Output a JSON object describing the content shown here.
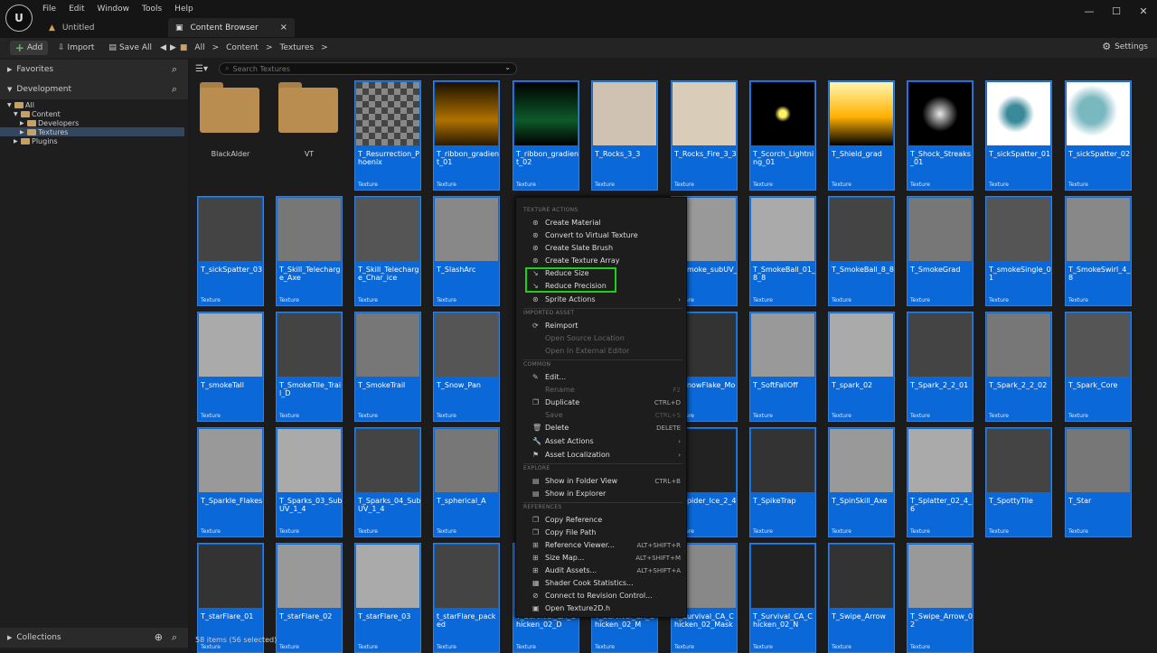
{
  "app": {
    "logo_text": "U",
    "menu": [
      "File",
      "Edit",
      "Window",
      "Tools",
      "Help"
    ],
    "tabs": [
      {
        "label": "Untitled"
      },
      {
        "label": "Content Browser",
        "close": "×"
      }
    ],
    "window_controls": [
      "—",
      "☐",
      "✕"
    ]
  },
  "toolbar": {
    "add_label": "Add",
    "import_label": "Import",
    "save_all_label": "Save All",
    "breadcrumbs": [
      "All",
      ">",
      "Content",
      ">",
      "Textures",
      ">"
    ],
    "settings_label": "Settings"
  },
  "sidebar": {
    "favorites_label": "Favorites",
    "development_label": "Development",
    "collections_label": "Collections",
    "tree": [
      {
        "label": "All"
      },
      {
        "label": "Content"
      },
      {
        "label": "Developers"
      },
      {
        "label": "Textures"
      },
      {
        "label": "Plugins"
      }
    ]
  },
  "content": {
    "search_placeholder": "Search Textures",
    "type_label": "Texture",
    "folders": [
      "BlackAlder",
      "VT"
    ],
    "assets": [
      "T_Resurrection_Phoenix",
      "T_ribbon_gradient_01",
      "T_ribbon_gradient_02",
      "T_Rocks_3_3",
      "T_Rocks_Fire_3_3",
      "T_Scorch_Lightning_01",
      "T_Shield_grad",
      "T_Shock_Streaks_01",
      "T_sickSpatter_01",
      "T_sickSpatter_02",
      "T_sickSpatter_03",
      "T_Skill_Telecharge_Axe",
      "T_Skill_Telecharge_Char_ice",
      "T_SlashArc",
      "",
      "",
      "T_Smoke_subUV_",
      "T_SmokeBall_01_8_8",
      "T_SmokeBall_8_8",
      "T_SmokeGrad",
      "T_smokeSingle_01",
      "T_SmokeSwirl_4_8",
      "T_smokeTall",
      "T_SmokeTile_Trail_D",
      "T_SmokeTrail",
      "T_Snow_Pan",
      "",
      "",
      "T_SnowFlake_Mobile",
      "T_SoftFallOff",
      "T_spark_02",
      "T_Spark_2_2_01",
      "T_Spark_2_2_02",
      "T_Spark_Core",
      "T_Sparkle_Flakes",
      "T_Sparks_03_SubUV_1_4",
      "T_Sparks_04_SubUV_1_4",
      "T_spherical_A",
      "",
      "",
      "T_Spider_Ice_2_4",
      "T_SpikeTrap",
      "T_SpinSkill_Axe",
      "T_Splatter_02_4_6",
      "T_SpottyTile",
      "T_Star",
      "T_starFlare_01",
      "T_starFlare_02",
      "T_starFlare_03",
      "t_starFlare_packed",
      "T_Survival_CA_Chicken_02_D",
      "T_Survival_CA_Chicken_02_M",
      "T_Survival_CA_Chicken_02_Mask",
      "T_Survival_CA_Chicken_02_N",
      "T_Swipe_Arrow",
      "T_Swipe_Arrow_02"
    ]
  },
  "status": "58 items (56 selected)",
  "context_menu": {
    "sections": {
      "texture_actions": "TEXTURE ACTIONS",
      "imported_asset": "IMPORTED ASSET",
      "common": "COMMON",
      "explore": "EXPLORE",
      "references": "REFERENCES"
    },
    "items": {
      "create_material": "Create Material",
      "convert_vt": "Convert to Virtual Texture",
      "create_slate_brush": "Create Slate Brush",
      "create_texture_array": "Create Texture Array",
      "reduce_size": "Reduce Size",
      "reduce_precision": "Reduce Precision",
      "sprite_actions": "Sprite Actions",
      "reimport": "Reimport",
      "open_source_location": "Open Source Location",
      "open_external_editor": "Open In External Editor",
      "edit": "Edit...",
      "rename": "Rename",
      "rename_key": "F2",
      "duplicate": "Duplicate",
      "duplicate_key": "CTRL+D",
      "save": "Save",
      "save_key": "CTRL+S",
      "delete": "Delete",
      "delete_key": "DELETE",
      "asset_actions": "Asset Actions",
      "asset_localization": "Asset Localization",
      "show_folder_view": "Show in Folder View",
      "show_folder_view_key": "CTRL+B",
      "show_explorer": "Show in Explorer",
      "copy_reference": "Copy Reference",
      "copy_file_path": "Copy File Path",
      "reference_viewer": "Reference Viewer...",
      "reference_viewer_key": "ALT+SHIFT+R",
      "size_map": "Size Map...",
      "size_map_key": "ALT+SHIFT+M",
      "audit_assets": "Audit Assets...",
      "audit_assets_key": "ALT+SHIFT+A",
      "shader_cook_stats": "Shader Cook Statistics...",
      "connect_revision": "Connect to Revision Control...",
      "open_texture2d": "Open Texture2D.h"
    },
    "highlight_color": "#19d319"
  }
}
